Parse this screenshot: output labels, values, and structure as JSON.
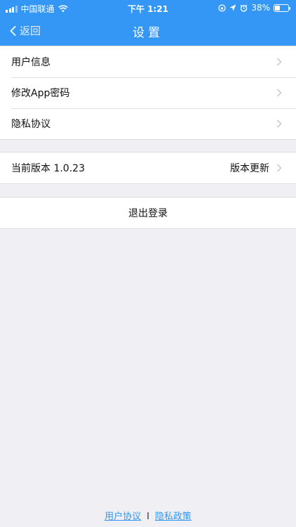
{
  "status_bar": {
    "carrier": "中国联通",
    "time": "下午 1:21",
    "battery_percent": "38%",
    "battery_level": 0.38,
    "icons": [
      "signal-icon",
      "wifi-icon",
      "lock-rotation-icon",
      "location-icon",
      "alarm-icon",
      "battery-icon"
    ]
  },
  "nav": {
    "back_label": "返回",
    "title": "设置"
  },
  "settings_group_1": {
    "items": [
      {
        "label": "用户信息"
      },
      {
        "label": "修改App密码"
      },
      {
        "label": "隐私协议"
      }
    ]
  },
  "version_row": {
    "label": "当前版本 1.0.23",
    "action": "版本更新"
  },
  "logout": {
    "label": "退出登录"
  },
  "footer": {
    "user_agreement": "用户协议",
    "separator": "I",
    "privacy_policy": "隐私政策"
  },
  "colors": {
    "accent": "#3496f5",
    "background": "#efeff4",
    "cell": "#ffffff"
  }
}
